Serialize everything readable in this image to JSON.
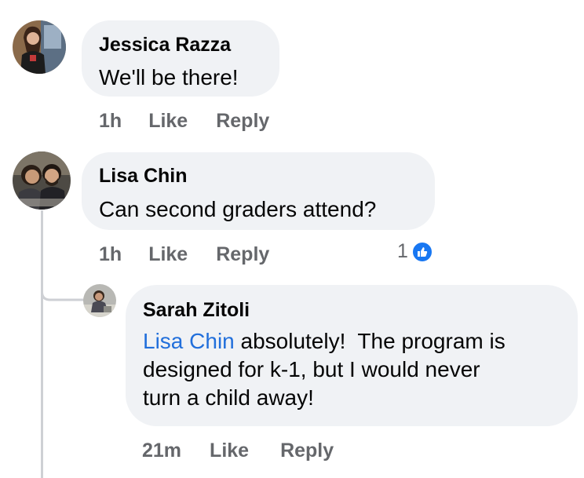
{
  "comments": [
    {
      "author": "Jessica Razza",
      "text": "We'll be there!",
      "time": "1h",
      "like_label": "Like",
      "reply_label": "Reply"
    },
    {
      "author": "Lisa Chin",
      "text": "Can second graders attend?",
      "time": "1h",
      "like_label": "Like",
      "reply_label": "Reply",
      "reaction_count": "1",
      "reaction_icon": "thumbs-up-icon"
    }
  ],
  "reply": {
    "author": "Sarah Zitoli",
    "mention": "Lisa Chin",
    "text_line1": " absolutely!  The program is",
    "text_line2": "designed for k-1, but I would never",
    "text_line3": "turn a child away!",
    "time": "21m",
    "like_label": "Like",
    "reply_label": "Reply"
  },
  "colors": {
    "bubble": "#f0f2f5",
    "mention": "#216fdb",
    "reaction": "#1877f2",
    "meta": "#65676b"
  }
}
